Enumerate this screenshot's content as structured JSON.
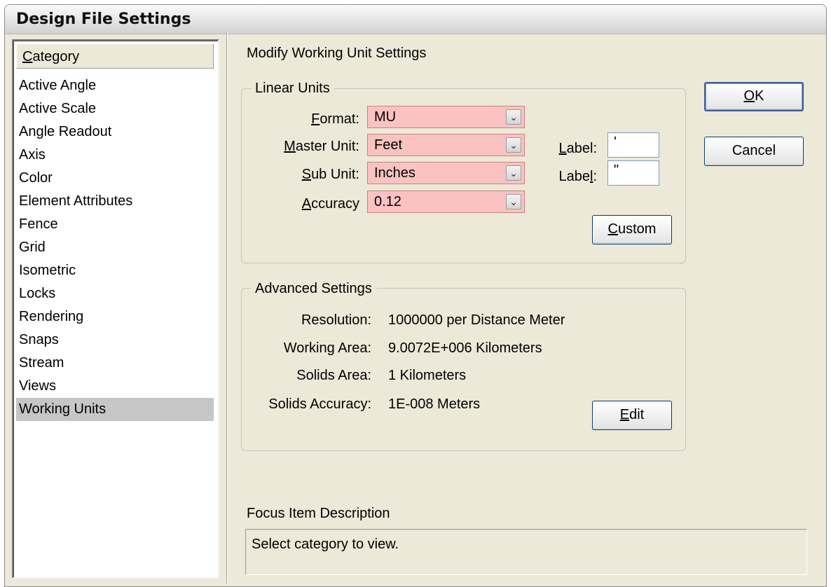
{
  "window": {
    "title": "Design File Settings"
  },
  "category": {
    "header": "Category",
    "items": [
      {
        "label": "Active Angle",
        "selected": false
      },
      {
        "label": "Active Scale",
        "selected": false
      },
      {
        "label": "Angle Readout",
        "selected": false
      },
      {
        "label": "Axis",
        "selected": false
      },
      {
        "label": "Color",
        "selected": false
      },
      {
        "label": "Element Attributes",
        "selected": false
      },
      {
        "label": "Fence",
        "selected": false
      },
      {
        "label": "Grid",
        "selected": false
      },
      {
        "label": "Isometric",
        "selected": false
      },
      {
        "label": "Locks",
        "selected": false
      },
      {
        "label": "Rendering",
        "selected": false
      },
      {
        "label": "Snaps",
        "selected": false
      },
      {
        "label": "Stream",
        "selected": false
      },
      {
        "label": "Views",
        "selected": false
      },
      {
        "label": "Working Units",
        "selected": true
      }
    ]
  },
  "main": {
    "section_title": "Modify Working Unit Settings"
  },
  "linear_units": {
    "legend": "Linear Units",
    "format_label": "Format:",
    "format_value": "MU",
    "master_unit_label": "Master Unit:",
    "master_unit_value": "Feet",
    "sub_unit_label": "Sub Unit:",
    "sub_unit_value": "Inches",
    "accuracy_label": "Accuracy",
    "accuracy_value": "0.12",
    "master_label_label": "Label:",
    "master_label_value": "'",
    "sub_label_label": "Label:",
    "sub_label_value": "\"",
    "custom_button": "Custom",
    "dropdown_glyph": "⌄",
    "field_highlight_color": "#fbc2c2"
  },
  "advanced": {
    "legend": "Advanced Settings",
    "resolution_label": "Resolution:",
    "resolution_value": "1000000 per Distance Meter",
    "working_area_label": "Working Area:",
    "working_area_value": "9.0072E+006 Kilometers",
    "solids_area_label": "Solids Area:",
    "solids_area_value": "1 Kilometers",
    "solids_accuracy_label": "Solids Accuracy:",
    "solids_accuracy_value": "1E-008 Meters",
    "edit_button": "Edit"
  },
  "focus": {
    "title": "Focus Item Description",
    "text": "Select category to view."
  },
  "buttons": {
    "ok": "OK",
    "cancel": "Cancel"
  }
}
